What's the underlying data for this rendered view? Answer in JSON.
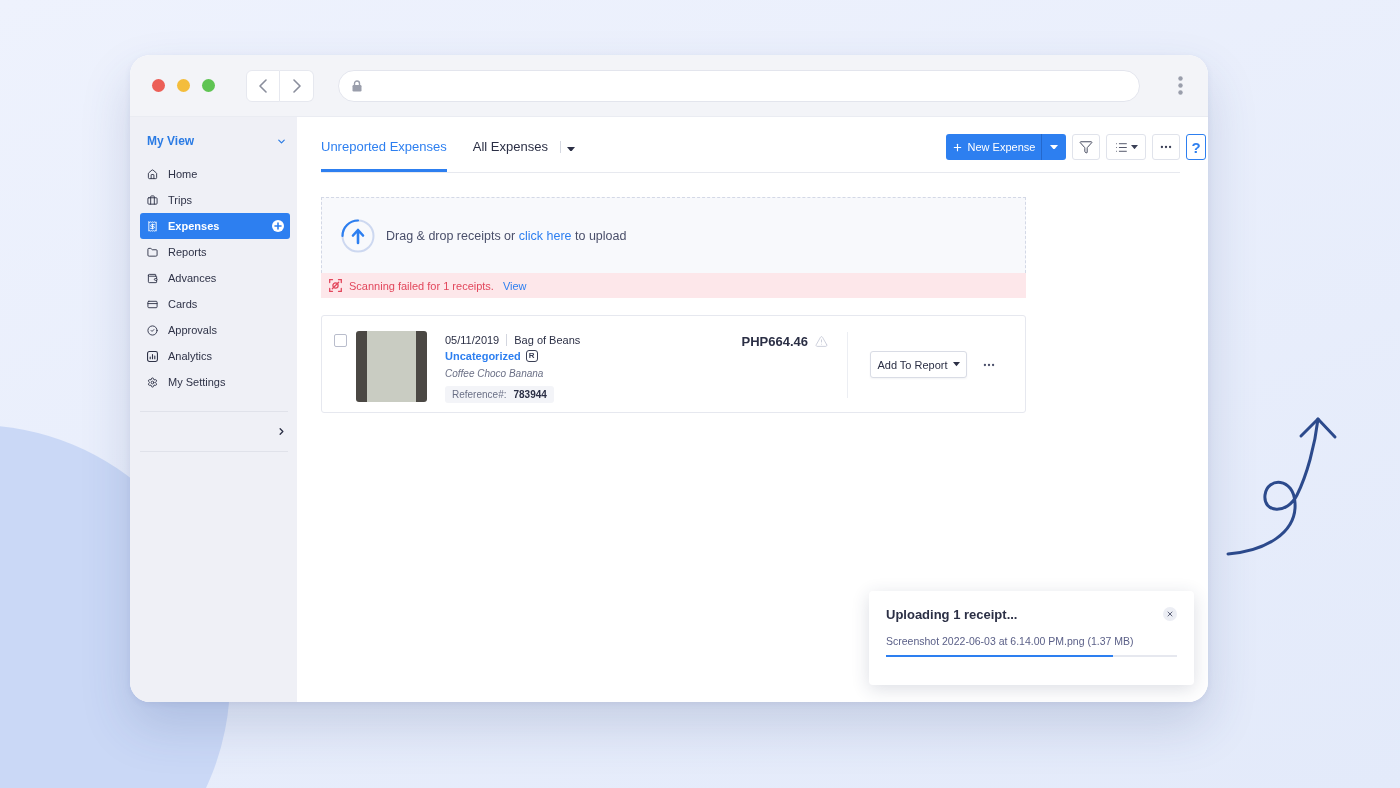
{
  "sidebar": {
    "title": "My View",
    "expanded": true,
    "items": [
      {
        "label": "Home",
        "selected": false
      },
      {
        "label": "Trips",
        "selected": false
      },
      {
        "label": "Expenses",
        "selected": true
      },
      {
        "label": "Reports",
        "selected": false
      },
      {
        "label": "Advances",
        "selected": false
      },
      {
        "label": "Cards",
        "selected": false
      },
      {
        "label": "Approvals",
        "selected": false
      },
      {
        "label": "Analytics",
        "selected": false
      },
      {
        "label": "My Settings",
        "selected": false
      }
    ]
  },
  "tabs": [
    {
      "label": "Unreported Expenses",
      "selected": true,
      "dropdown": false
    },
    {
      "label": "All Expenses",
      "selected": false,
      "dropdown": true
    }
  ],
  "toolbar": {
    "new_button": "New Expense",
    "help": "?"
  },
  "upload": {
    "text_before": "Drag & drop receipts or",
    "link": "click here",
    "text_after": "to upload"
  },
  "scan_error": {
    "message": "Scanning failed for 1 receipts.",
    "link": "View"
  },
  "expenses": [
    {
      "checked": false,
      "date": "05/11/2019",
      "merchant": "Bag of Beans",
      "category": "Uncategorized",
      "category_mark": "R",
      "description": "Coffee Choco Banana",
      "reference_label": "Reference#:",
      "reference": "783944",
      "amount": "PHP664.46",
      "warning": true,
      "action": "Add To Report"
    }
  ],
  "upload_toast": {
    "title": "Uploading 1 receipt...",
    "file": "Screenshot 2022-06-03 at 6.14.00 PM.png (1.37 MB)",
    "level": 0.78
  }
}
